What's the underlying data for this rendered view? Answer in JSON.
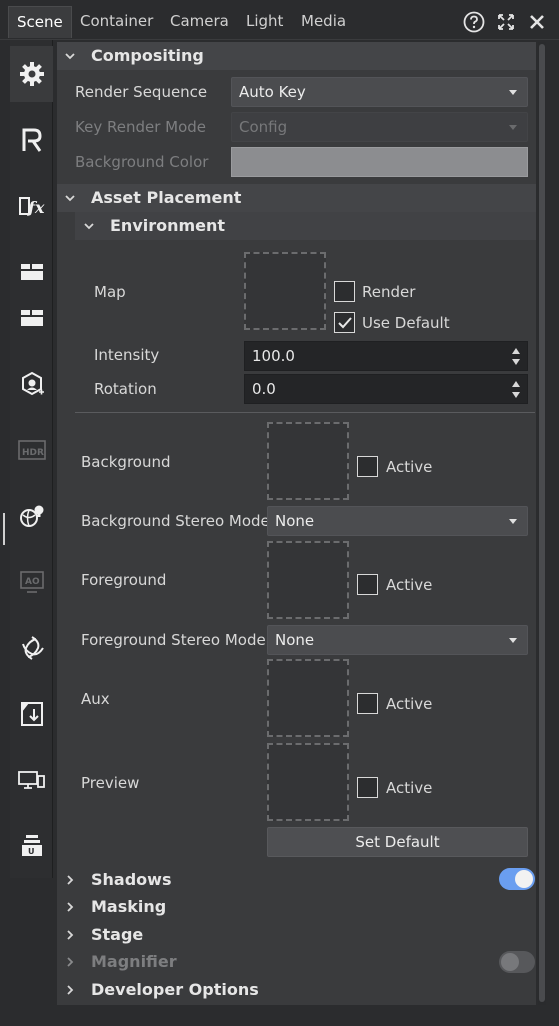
{
  "tabs": [
    {
      "label": "Scene",
      "active": true
    },
    {
      "label": "Container"
    },
    {
      "label": "Camera"
    },
    {
      "label": "Light"
    },
    {
      "label": "Media"
    }
  ],
  "toolbar_icons": [
    "help-icon",
    "expand-icon",
    "close-icon"
  ],
  "sidebar_icons": [
    "gear-icon",
    "render-r-icon",
    "fx-icon",
    "layers-top-icon",
    "layers-bottom-icon",
    "scene-object-icon",
    "hdr-icon",
    "globe-light-icon",
    "ao-icon",
    "lens-icon",
    "import-icon",
    "devices-icon",
    "stack-icon"
  ],
  "compositing": {
    "title": "Compositing",
    "render_sequence": {
      "label": "Render Sequence",
      "value": "Auto Key"
    },
    "key_render_mode": {
      "label": "Key Render Mode",
      "value": "Config"
    },
    "background_color": {
      "label": "Background Color",
      "color": "#8c8d90"
    }
  },
  "asset_placement": {
    "title": "Asset Placement",
    "environment": {
      "title": "Environment",
      "map_label": "Map",
      "render_label": "Render",
      "render_checked": false,
      "use_default_label": "Use Default",
      "use_default_checked": true,
      "intensity": {
        "label": "Intensity",
        "value": "100.0"
      },
      "rotation": {
        "label": "Rotation",
        "value": "0.0"
      }
    },
    "background": {
      "label": "Background",
      "active_label": "Active"
    },
    "background_stereo": {
      "label": "Background Stereo Mode",
      "value": "None"
    },
    "foreground": {
      "label": "Foreground",
      "active_label": "Active"
    },
    "foreground_stereo": {
      "label": "Foreground Stereo Mode",
      "value": "None"
    },
    "aux": {
      "label": "Aux",
      "active_label": "Active"
    },
    "preview": {
      "label": "Preview",
      "active_label": "Active"
    },
    "set_default_label": "Set Default"
  },
  "sections": {
    "shadows": {
      "title": "Shadows",
      "toggle_on": true
    },
    "masking": {
      "title": "Masking"
    },
    "stage": {
      "title": "Stage"
    },
    "magnifier": {
      "title": "Magnifier",
      "toggle_on": false
    },
    "developer_options": {
      "title": "Developer Options"
    }
  },
  "colors": {
    "accent": "#6a9ef0",
    "panel": "#3a3b3d",
    "header": "#444548"
  }
}
